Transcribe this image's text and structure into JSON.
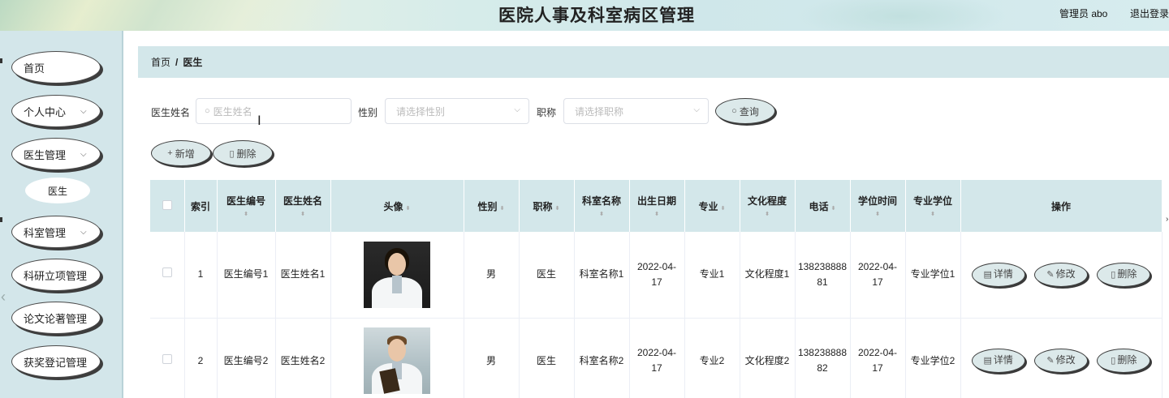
{
  "header": {
    "title": "医院人事及科室病区管理",
    "user": "管理员 abo",
    "logout": "退出登录"
  },
  "sidebar": {
    "items": [
      {
        "label": "首页"
      },
      {
        "label": "个人中心"
      },
      {
        "label": "医生管理"
      },
      {
        "label": "医生"
      },
      {
        "label": "科室管理"
      },
      {
        "label": "科研立项管理"
      },
      {
        "label": "论文论著管理"
      },
      {
        "label": "获奖登记管理"
      }
    ]
  },
  "breadcrumb": {
    "home": "首页",
    "separator": "/",
    "current": "医生"
  },
  "search": {
    "name_label": "医生姓名",
    "name_placeholder": "医生姓名",
    "gender_label": "性别",
    "gender_placeholder": "请选择性别",
    "title_label": "职称",
    "title_placeholder": "请选择职称",
    "query_button": "查询"
  },
  "actions": {
    "add_button": "新增",
    "delete_button": "删除"
  },
  "table": {
    "headers": [
      "索引",
      "医生编号",
      "医生姓名",
      "头像",
      "性别",
      "职称",
      "科室名称",
      "出生日期",
      "专业",
      "文化程度",
      "电话",
      "学位时间",
      "专业学位",
      "操作"
    ],
    "rows": [
      {
        "index": "1",
        "doctor_no": "医生编号1",
        "doctor_name": "医生姓名1",
        "gender": "男",
        "title": "医生",
        "department": "科室名称1",
        "birth_date": "2022-04-17",
        "major": "专业1",
        "education": "文化程度1",
        "phone": "13823888881",
        "degree_date": "2022-04-17",
        "degree": "专业学位1"
      },
      {
        "index": "2",
        "doctor_no": "医生编号2",
        "doctor_name": "医生姓名2",
        "gender": "男",
        "title": "医生",
        "department": "科室名称2",
        "birth_date": "2022-04-17",
        "major": "专业2",
        "education": "文化程度2",
        "phone": "13823888882",
        "degree_date": "2022-04-17",
        "degree": "专业学位2"
      }
    ],
    "row_actions": {
      "detail": "详情",
      "edit": "修改",
      "delete": "删除"
    }
  },
  "colors": {
    "accent": "#d3e7ea",
    "pill": "#dce9ea",
    "sidebar": "#d3e6ea"
  }
}
